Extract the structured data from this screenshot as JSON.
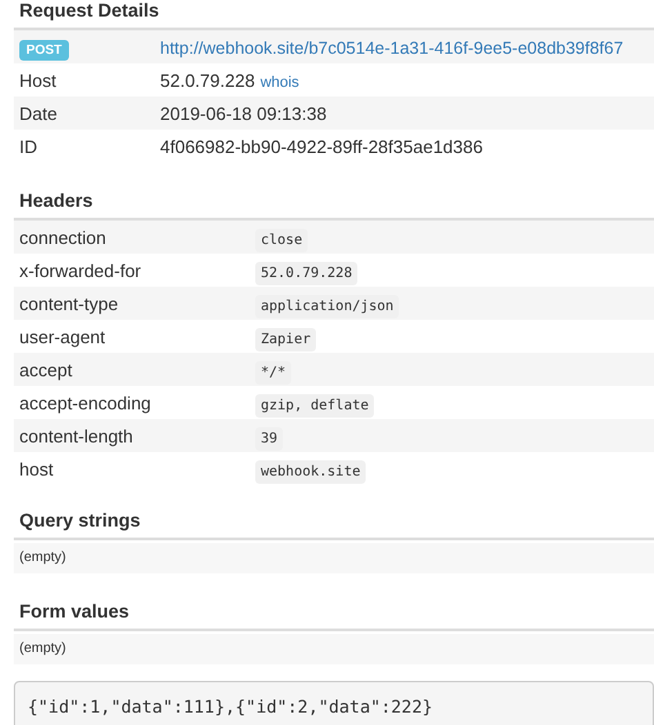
{
  "request_details": {
    "title": "Request Details",
    "method": "POST",
    "url": "http://webhook.site/b7c0514e-1a31-416f-9ee5-e08db39f8f67",
    "rows": [
      {
        "label": "Host",
        "value": "52.0.79.228",
        "link": "whois"
      },
      {
        "label": "Date",
        "value": "2019-06-18 09:13:38"
      },
      {
        "label": "ID",
        "value": "4f066982-bb90-4922-89ff-28f35ae1d386"
      }
    ]
  },
  "headers": {
    "title": "Headers",
    "rows": [
      {
        "name": "connection",
        "value": "close"
      },
      {
        "name": "x-forwarded-for",
        "value": "52.0.79.228"
      },
      {
        "name": "content-type",
        "value": "application/json"
      },
      {
        "name": "user-agent",
        "value": "Zapier"
      },
      {
        "name": "accept",
        "value": "*/*"
      },
      {
        "name": "accept-encoding",
        "value": "gzip, deflate"
      },
      {
        "name": "content-length",
        "value": "39"
      },
      {
        "name": "host",
        "value": "webhook.site"
      }
    ]
  },
  "query_strings": {
    "title": "Query strings",
    "value": "(empty)"
  },
  "form_values": {
    "title": "Form values",
    "value": "(empty)"
  },
  "body": "{\"id\":1,\"data\":111},{\"id\":2,\"data\":222}"
}
